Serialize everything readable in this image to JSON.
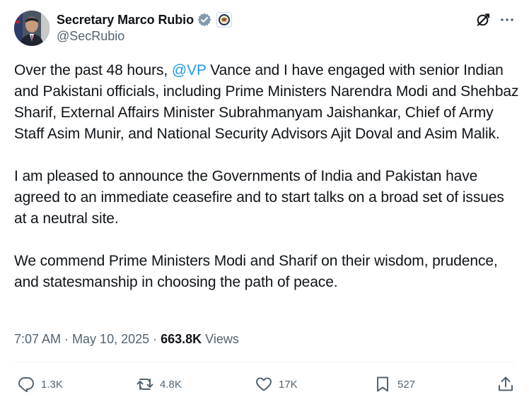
{
  "author": {
    "display_name": "Secretary Marco Rubio",
    "handle": "@SecRubio",
    "verified_icon": "verified-badge-icon",
    "affiliation_icon": "state-department-seal-icon",
    "avatar": "profile-photo"
  },
  "header_icons": {
    "grok": "grok-icon",
    "more": "more-options-icon"
  },
  "tweet": {
    "p1_before": "Over the past 48 hours, ",
    "p1_mention": "@VP",
    "p1_after": " Vance and I have engaged with senior Indian and Pakistani officials, including Prime Ministers Narendra Modi and Shehbaz Sharif, External Affairs Minister Subrahmanyam Jaishankar, Chief of Army Staff Asim Munir, and National Security Advisors Ajit Doval and Asim Malik.",
    "p2": "I am pleased to announce the Governments of India and Pakistan have agreed to an immediate ceasefire and to start talks on a broad set of issues at a neutral site.",
    "p3": "We commend Prime Ministers Modi and Sharif on their wisdom, prudence, and statesmanship in choosing the path of peace."
  },
  "meta": {
    "time": "7:07 AM",
    "sep1": " · ",
    "date": "May 10, 2025",
    "sep2": " · ",
    "views_count": "663.8K",
    "views_label": " Views"
  },
  "actions": {
    "replies": "1.3K",
    "reposts": "4.8K",
    "likes": "17K",
    "bookmarks": "527"
  },
  "colors": {
    "text": "#0f1419",
    "secondary": "#536471",
    "accent": "#1d9bf0",
    "divider": "#eff3f4"
  }
}
